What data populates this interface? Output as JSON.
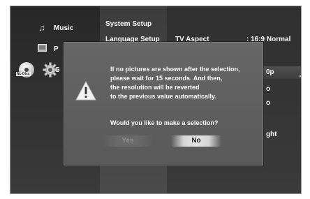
{
  "menu": {
    "items": [
      {
        "label": "Music",
        "icon": "music-note-icon"
      },
      {
        "label": "P",
        "icon": "photo-icon"
      },
      {
        "label": "S",
        "icon": "gear-icon"
      }
    ],
    "no_disc_label": "No Disc"
  },
  "submenu": {
    "items": [
      "System Setup",
      "Language Setup"
    ]
  },
  "settings": {
    "tv_aspect_label": "TV Aspect",
    "tv_aspect_value": ":  16:9 Normal",
    "partial_values": [
      "0p",
      "o",
      "o",
      "ght"
    ]
  },
  "dialog": {
    "message_lines": [
      "If no pictures are shown after the selection,",
      "please wait for 15 seconds. And then,",
      "the resolution will be reverted",
      "to the previous value automatically."
    ],
    "question": "Would you like to make a selection?",
    "yes_label": "Yes",
    "no_label": "No",
    "icon": "warning-icon"
  },
  "colors": {
    "background": "#3a3a3a",
    "dialog": "#606060",
    "selected_button": "#e0e0e0",
    "text": "#ffffff"
  }
}
